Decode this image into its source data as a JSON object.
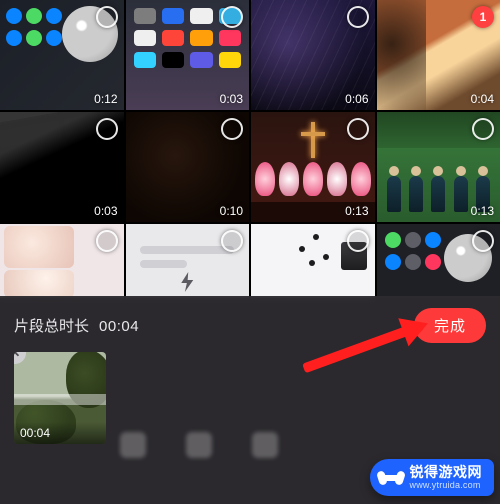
{
  "gallery": {
    "tiles": [
      {
        "duration": "0:12",
        "selected": false,
        "kind": "control-center"
      },
      {
        "duration": "0:03",
        "selected": false,
        "kind": "home-screen"
      },
      {
        "duration": "0:06",
        "selected": false,
        "kind": "abstract-lines"
      },
      {
        "duration": "0:04",
        "selected": true,
        "selectIndex": "1",
        "kind": "sunset-tree"
      },
      {
        "duration": "0:03",
        "selected": false,
        "kind": "keyboard"
      },
      {
        "duration": "0:10",
        "selected": false,
        "kind": "dark-room"
      },
      {
        "duration": "0:13",
        "selected": false,
        "kind": "church-cross"
      },
      {
        "duration": "0:13",
        "selected": false,
        "kind": "stage-people"
      },
      {
        "duration": "",
        "selected": false,
        "kind": "selfie"
      },
      {
        "duration": "",
        "selected": false,
        "kind": "chat-ui"
      },
      {
        "duration": "",
        "selected": false,
        "kind": "settings-ui"
      },
      {
        "duration": "",
        "selected": false,
        "kind": "control-center-2"
      }
    ]
  },
  "panel": {
    "totalLabel": "片段总时长",
    "totalValue": "00:04",
    "doneLabel": "完成"
  },
  "clip": {
    "duration": "00:04",
    "closeGlyph": "✕"
  },
  "watermark": {
    "brand": "锐得游戏网",
    "url": "www.ytruida.com"
  }
}
